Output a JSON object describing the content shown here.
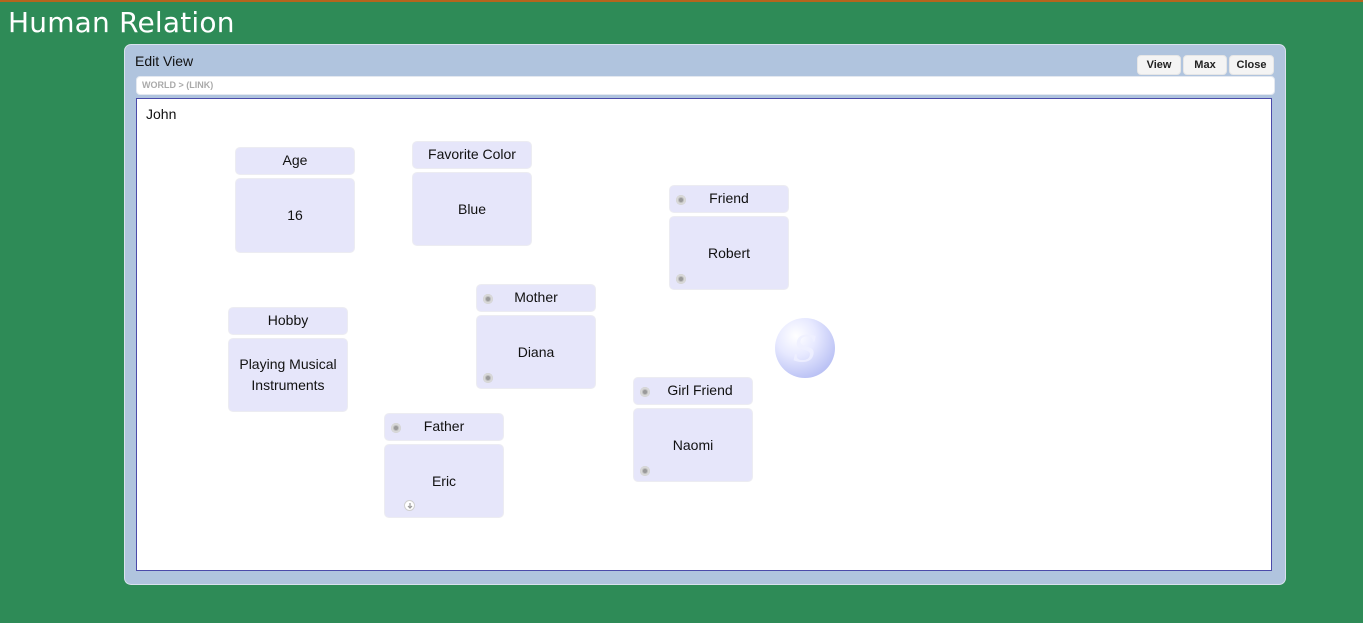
{
  "app": {
    "title": "Human Relation"
  },
  "panel": {
    "title": "Edit View",
    "buttons": {
      "view": "View",
      "max": "Max",
      "close": "Close"
    },
    "breadcrumb": "WORLD > (LINK)"
  },
  "canvas": {
    "title": "John",
    "cards": {
      "age": {
        "label": "Age",
        "value": "16"
      },
      "favorite_color": {
        "label": "Favorite Color",
        "value": "Blue"
      },
      "friend": {
        "label": "Friend",
        "value": "Robert"
      },
      "mother": {
        "label": "Mother",
        "value": "Diana"
      },
      "hobby": {
        "label": "Hobby",
        "value": "Playing Musical Instruments"
      },
      "girl_friend": {
        "label": "Girl Friend",
        "value": "Naomi"
      },
      "father": {
        "label": "Father",
        "value": "Eric"
      }
    },
    "logo_icon": "sphere-logo-icon"
  },
  "colors": {
    "background": "#2e8b57",
    "panel": "#b0c4de",
    "card": "#e6e6fa",
    "canvas_border": "#4b4baa"
  }
}
